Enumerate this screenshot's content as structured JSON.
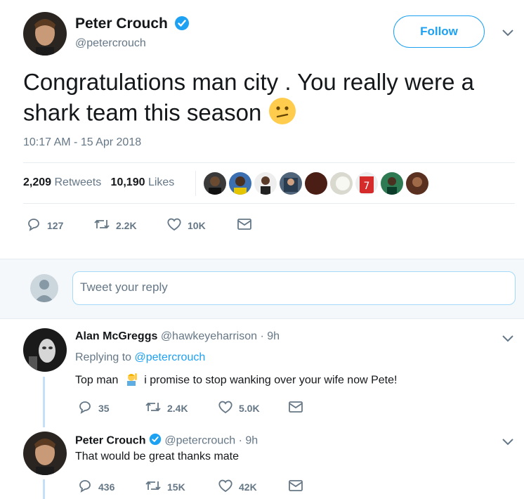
{
  "main_tweet": {
    "author_name": "Peter Crouch",
    "author_handle": "@petercrouch",
    "follow_label": "Follow",
    "text": "Congratulations man city . You really were a shark team this season",
    "timestamp": "10:17 AM - 15 Apr 2018",
    "retweets_count": "2,209",
    "retweets_label": "Retweets",
    "likes_count": "10,190",
    "likes_label": "Likes",
    "actions": {
      "replies": "127",
      "retweets": "2.2K",
      "likes": "10K"
    }
  },
  "reply_box": {
    "placeholder": "Tweet your reply"
  },
  "replies": [
    {
      "author_name": "Alan McGreggs",
      "author_handle": "@hawkeyeharrison",
      "time": "· 9h",
      "replying_to_label": "Replying to",
      "replying_to_handle": "@petercrouch",
      "text_before_emoji": "Top man",
      "text_after_emoji": "i promise to stop wanking over your wife now Pete!",
      "actions": {
        "replies": "35",
        "retweets": "2.4K",
        "likes": "5.0K"
      }
    },
    {
      "author_name": "Peter Crouch",
      "author_handle": "@petercrouch",
      "time": "· 9h",
      "text": "That would be great thanks mate",
      "actions": {
        "replies": "436",
        "retweets": "15K",
        "likes": "42K"
      }
    }
  ],
  "colors": {
    "accent": "#1da1f2",
    "secondary_text": "#657786",
    "divider": "#e6ecf0",
    "thread_line": "#c4dff6"
  },
  "icons": [
    "verified-icon",
    "chevron-down-icon",
    "reply-icon",
    "retweet-icon",
    "like-icon",
    "message-icon",
    "confused-face-emoji",
    "raising-hand-emoji",
    "default-avatar-icon"
  ]
}
